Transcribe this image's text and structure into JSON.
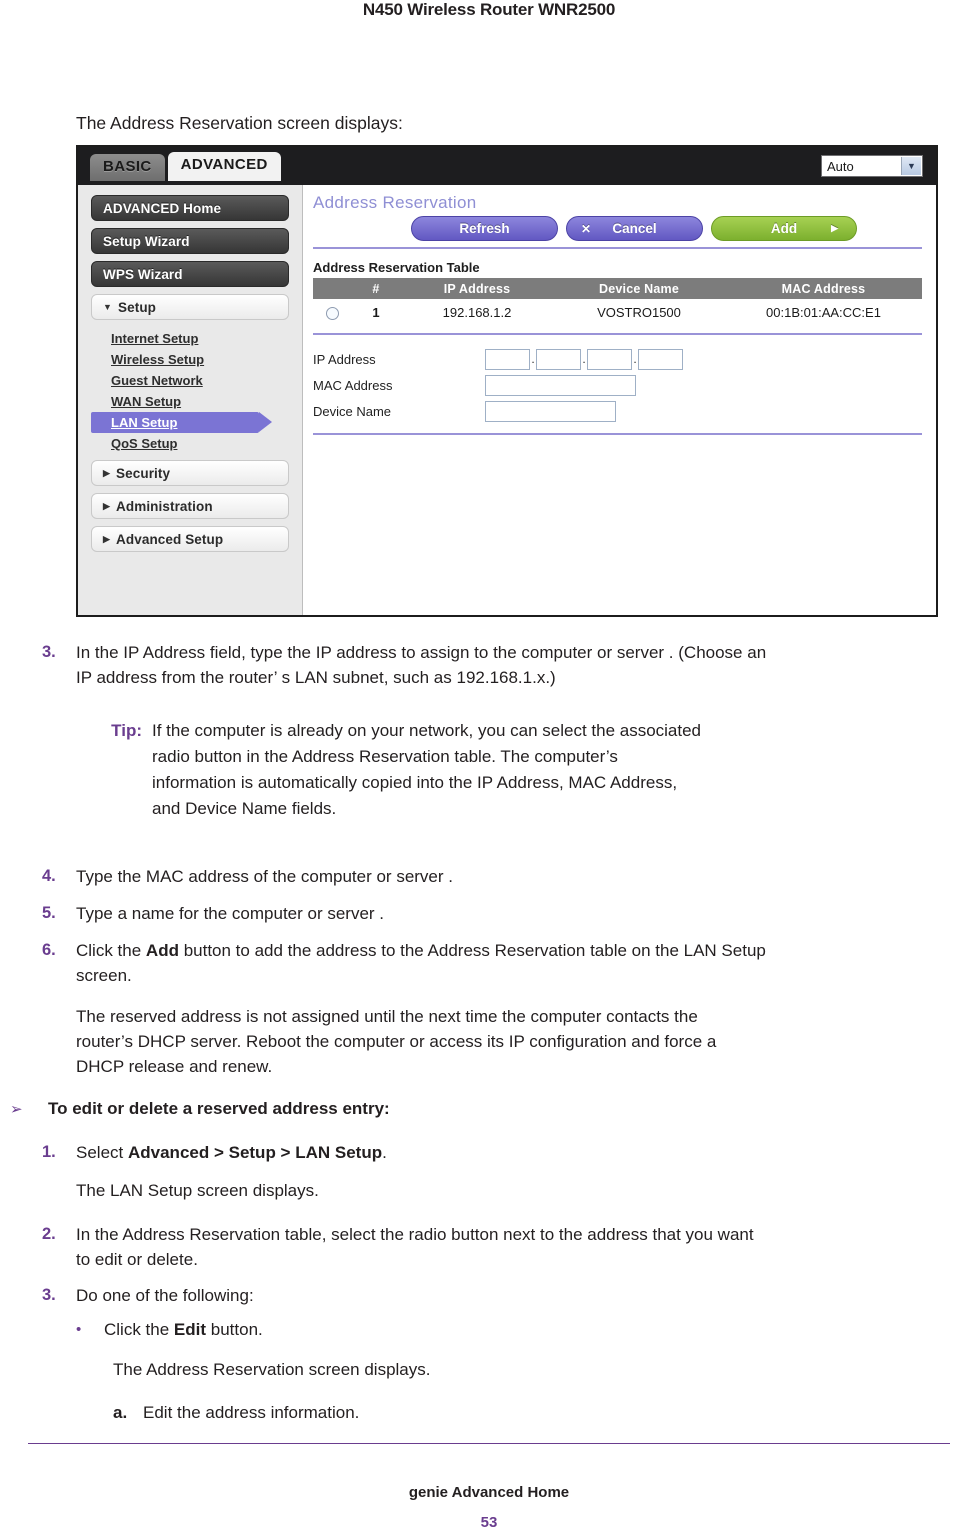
{
  "page": {
    "header_title": "N450 Wireless Router WNR2500",
    "intro_line": "The Address Reservation screen displays:",
    "footer_title": "genie Advanced Home",
    "footer_page_number": "53",
    "accent_purple": "#6a3d8f",
    "ui_purple": "#7b74d4",
    "ui_green": "#8bc53f"
  },
  "router_ui": {
    "tabs": [
      {
        "label": "BASIC",
        "active": false
      },
      {
        "label": "ADVANCED",
        "active": true
      }
    ],
    "language_select": {
      "value": "Auto",
      "caret_icon": "chevron-down-icon"
    },
    "nav_buttons": [
      {
        "label": "ADVANCED Home",
        "style": "dark"
      },
      {
        "label": "Setup Wizard",
        "style": "dark"
      },
      {
        "label": "WPS Wizard",
        "style": "dark"
      }
    ],
    "nav_groups": [
      {
        "label": "Setup",
        "caret": "▼",
        "expanded": true
      },
      {
        "label": "Security",
        "caret": "▶",
        "expanded": false
      },
      {
        "label": "Administration",
        "caret": "▶",
        "expanded": false
      },
      {
        "label": "Advanced Setup",
        "caret": "▶",
        "expanded": false
      }
    ],
    "sub_links": [
      {
        "label": "Internet Setup",
        "selected": false
      },
      {
        "label": "Wireless Setup",
        "selected": false
      },
      {
        "label": "Guest Network",
        "selected": false
      },
      {
        "label": "WAN Setup",
        "selected": false
      },
      {
        "label": "LAN Setup",
        "selected": true
      },
      {
        "label": "QoS Setup",
        "selected": false
      }
    ],
    "panel_title": "Address Reservation",
    "action_buttons": [
      {
        "label": "Refresh",
        "color": "purple",
        "lead": "",
        "trail": ""
      },
      {
        "label": "Cancel",
        "color": "purple",
        "lead": "✕",
        "trail": ""
      },
      {
        "label": "Add",
        "color": "green",
        "lead": "",
        "trail": "▶"
      }
    ],
    "table_caption": "Address Reservation Table",
    "table_headers": [
      "",
      "#",
      "IP Address",
      "Device Name",
      "MAC Address"
    ],
    "table_rows": [
      {
        "selected": false,
        "num": "1",
        "ip": "192.168.1.2",
        "device": "VOSTRO1500",
        "mac": "00:1B:01:AA:CC:E1"
      }
    ],
    "form": {
      "ip_label": "IP Address",
      "mac_label": "MAC Address",
      "device_label": "Device Name",
      "ip_octets": [
        "",
        "",
        "",
        ""
      ],
      "mac_value": "",
      "device_value": ""
    }
  },
  "doc": {
    "step3": {
      "num": "3.",
      "line1": "In the IP Address field, type the IP address to assign to the computer or server . (Choose an",
      "line2": "IP address from the router’ s LAN subnet, such as 192.168.1.x.)"
    },
    "tip": {
      "label": "Tip:",
      "line1": "If the computer is already on your network, you can select the associated",
      "line2": "radio button in the Address Reservation table. The computer’s",
      "line3": "information is automatically copied into the IP Address, MAC Address,",
      "line4": "and Device Name fields."
    },
    "step4": {
      "num": "4.",
      "text": "Type the MAC address of the computer or server ."
    },
    "step5": {
      "num": "5.",
      "text": "Type a name for the computer or server ."
    },
    "step6": {
      "num": "6.",
      "pre": "Click the ",
      "bold": "Add",
      "post": " button to add the address to the Address Reservation table on the LAN Setup",
      "line2": "screen."
    },
    "para_reserved": {
      "line1": "The reserved address is not assigned until the next time the computer contacts the",
      "line2": "router’s DHCP server. Reboot the computer or access its IP configuration and force a",
      "line3": "DHCP release and renew."
    },
    "heading_edit": {
      "arrow": "➢",
      "text": "To edit or delete a reserved address entry:"
    },
    "edit_step1": {
      "num": "1.",
      "pre": "Select ",
      "bold": "Advanced > Setup > LAN Setup",
      "post": "."
    },
    "para_lan": "The LAN Setup screen displays.",
    "edit_step2": {
      "num": "2.",
      "line1": "In the Address Reservation table, select the radio button next to the address that you want",
      "line2": "to edit or delete."
    },
    "edit_step3": {
      "num": "3.",
      "text": "Do one of the following:"
    },
    "bullet_edit": {
      "dot": "•",
      "pre": "Click the ",
      "bold": "Edit",
      "post": " button."
    },
    "para_addr_res": "The Address Reservation screen displays.",
    "alpha_a": {
      "marker": "a.",
      "text": "Edit the address information."
    }
  }
}
